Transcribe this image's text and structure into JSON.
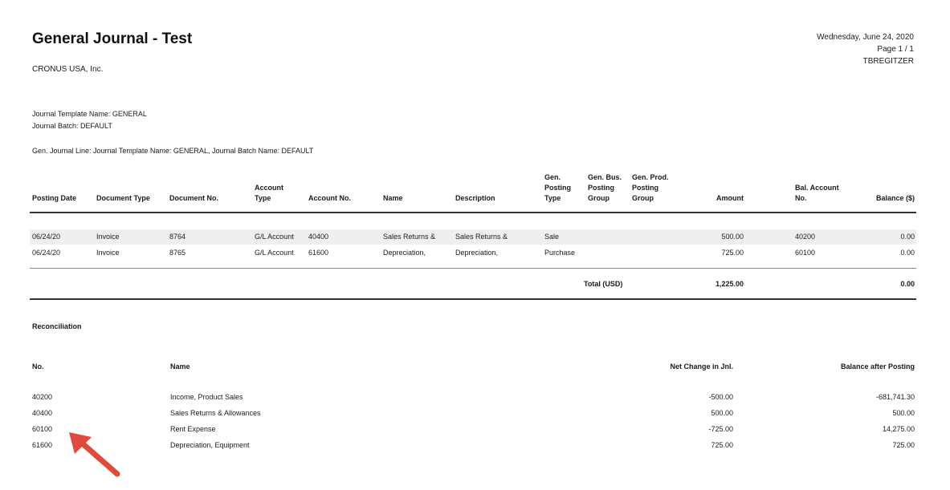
{
  "report": {
    "title": "General Journal - Test",
    "company": "CRONUS USA, Inc.",
    "date": "Wednesday, June 24, 2020",
    "page": "Page 1 / 1",
    "user": "TBREGITZER"
  },
  "filters": {
    "template": "Journal Template Name: GENERAL",
    "batch": "Journal Batch: DEFAULT",
    "line": "Gen. Journal Line: Journal Template Name: GENERAL, Journal Batch Name: DEFAULT"
  },
  "journal": {
    "headers": {
      "posting_date": "Posting Date",
      "document_type": "Document Type",
      "document_no": "Document No.",
      "account_type_1": "Account",
      "account_type_2": "Type",
      "account_no": "Account No.",
      "name": "Name",
      "description": "Description",
      "gen_posting_type_1": "Gen.",
      "gen_posting_type_2": "Posting",
      "gen_posting_type_3": "Type",
      "gen_bus_1": "Gen. Bus.",
      "gen_bus_2": "Posting",
      "gen_bus_3": "Group",
      "gen_prod_1": "Gen. Prod.",
      "gen_prod_2": "Posting",
      "gen_prod_3": "Group",
      "amount": "Amount",
      "bal_account_1": "Bal. Account",
      "bal_account_2": "No.",
      "balance": "Balance ($)"
    },
    "rows": [
      {
        "posting_date": "06/24/20",
        "document_type": "Invoice",
        "document_no": "8764",
        "account_type": "G/L Account",
        "account_no": "40400",
        "name": "Sales Returns &",
        "description": "Sales Returns &",
        "gen_posting_type": "Sale",
        "amount": "500.00",
        "bal_account_no": "40200",
        "balance": "0.00"
      },
      {
        "posting_date": "06/24/20",
        "document_type": "Invoice",
        "document_no": "8765",
        "account_type": "G/L Account",
        "account_no": "61600",
        "name": "Depreciation,",
        "description": "Depreciation,",
        "gen_posting_type": "Purchase",
        "amount": "725.00",
        "bal_account_no": "60100",
        "balance": "0.00"
      }
    ],
    "total": {
      "label": "Total (USD)",
      "amount": "1,225.00",
      "balance": "0.00"
    }
  },
  "reconciliation": {
    "title": "Reconciliation",
    "headers": {
      "no": "No.",
      "name": "Name",
      "net_change": "Net Change in Jnl.",
      "balance_after": "Balance after Posting"
    },
    "rows": [
      {
        "no": "40200",
        "name": "Income, Product Sales",
        "net_change": "-500.00",
        "balance_after": "-681,741.30"
      },
      {
        "no": "40400",
        "name": "Sales Returns & Allowances",
        "net_change": "500.00",
        "balance_after": "500.00"
      },
      {
        "no": "60100",
        "name": "Rent Expense",
        "net_change": "-725.00",
        "balance_after": "14,275.00"
      },
      {
        "no": "61600",
        "name": "Depreciation, Equipment",
        "net_change": "725.00",
        "balance_after": "725.00"
      }
    ]
  },
  "colors": {
    "arrow": "#e04a3a",
    "row_highlight": "#efefef"
  }
}
